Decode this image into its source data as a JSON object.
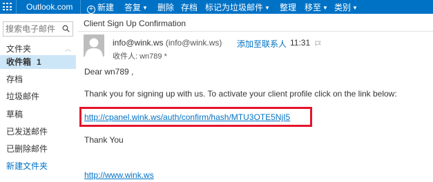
{
  "topbar": {
    "brand": "Outlook.com",
    "commands": {
      "new": "新建",
      "reply": "答复",
      "delete": "删除",
      "archive": "存档",
      "mark_junk": "标记为垃圾邮件",
      "sweep": "整理",
      "move": "移至",
      "categories": "类别"
    }
  },
  "sidebar": {
    "search_placeholder": "搜索电子邮件",
    "folders_header": "文件夹",
    "items": [
      {
        "label": "收件箱",
        "count": "1"
      },
      {
        "label": "存档"
      },
      {
        "label": "垃圾邮件"
      },
      {
        "label": "草稿"
      },
      {
        "label": "已发送邮件"
      },
      {
        "label": "已删除邮件"
      }
    ],
    "new_folder": "新建文件夹"
  },
  "message": {
    "subject": "Client Sign Up Confirmation",
    "sender_name": "info@wink.ws",
    "sender_address": "(info@wink.ws)",
    "add_contact": "添加至联系人",
    "time": "11:31",
    "recipient": "收件人: wn789 *",
    "greeting": "Dear wn789 ,",
    "paragraph": "Thank you for signing up with us. To activate your client profile click on the link below:",
    "confirm_link": "http://cpanel.wink.ws/auth/confirm/hash/MTU3OTE5NjI5",
    "thanks": "Thank You",
    "site_link": "http://www.wink.ws"
  },
  "colors": {
    "topbar": "#0072c6",
    "accent": "#0072c6",
    "active_folder": "#cde6f7",
    "highlight_box": "#e5132a"
  }
}
